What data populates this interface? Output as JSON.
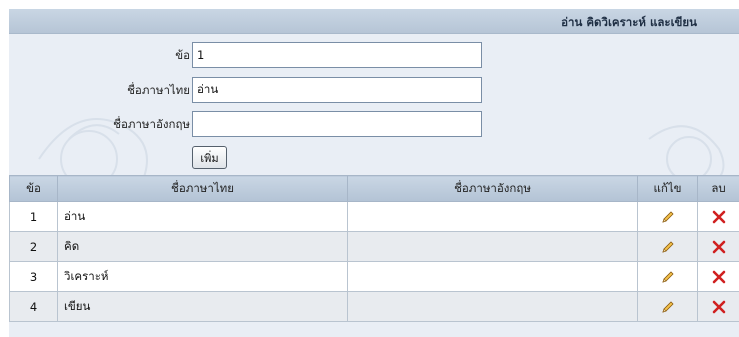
{
  "header": {
    "title": "อ่าน คิดวิเคราะห์ และเขียน"
  },
  "form": {
    "fields": [
      {
        "label": "ข้อ",
        "value": "1"
      },
      {
        "label": "ชื่อภาษาไทย",
        "value": "อ่าน"
      },
      {
        "label": "ชื่อภาษาอังกฤษ",
        "value": ""
      }
    ],
    "add_button": "เพิ่ม"
  },
  "table": {
    "columns": [
      "ข้อ",
      "ชื่อภาษาไทย",
      "ชื่อภาษาอังกฤษ",
      "แก้ไข",
      "ลบ"
    ],
    "rows": [
      {
        "no": "1",
        "thai": "อ่าน",
        "english": ""
      },
      {
        "no": "2",
        "thai": "คิด",
        "english": ""
      },
      {
        "no": "3",
        "thai": "วิเคราะห์",
        "english": ""
      },
      {
        "no": "4",
        "thai": "เขียน",
        "english": ""
      }
    ]
  },
  "colors": {
    "header_bg": "#c9d6e4",
    "panel_bg": "#e9eef5",
    "edit_icon": "#e0a22a",
    "delete_icon": "#d02020"
  },
  "icons": {
    "edit": "pencil-icon",
    "delete": "x-delete-icon"
  }
}
